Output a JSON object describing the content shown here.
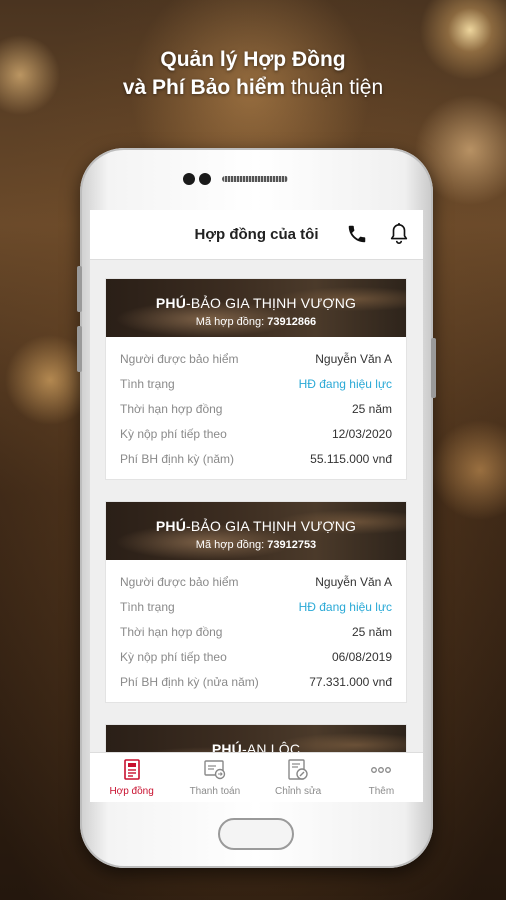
{
  "headline": {
    "line1": "Quản lý Hợp Đồng",
    "line2_bold": "và Phí Bảo hiểm",
    "line2_light": " thuận tiện"
  },
  "app": {
    "title": "Hợp đồng của tôi"
  },
  "contracts": [
    {
      "plan_bold": "PHÚ",
      "plan_rest": "-BẢO GIA THỊNH VƯỢNG",
      "number_label": "Mã hợp đồng: ",
      "number": "73912866",
      "rows": [
        {
          "label": "Người được bảo hiểm",
          "value": "Nguyễn Văn A"
        },
        {
          "label": "Tình trạng",
          "value": "HĐ đang hiệu lực"
        },
        {
          "label": "Thời hạn hợp đồng",
          "value": "25 năm"
        },
        {
          "label": "Kỳ nộp phí tiếp theo",
          "value": "12/03/2020"
        },
        {
          "label": "Phí BH định kỳ (năm)",
          "value": "55.115.000 vnđ"
        }
      ]
    },
    {
      "plan_bold": "PHÚ",
      "plan_rest": "-BẢO GIA THỊNH VƯỢNG",
      "number_label": "Mã hợp đồng: ",
      "number": "73912753",
      "rows": [
        {
          "label": "Người được bảo hiểm",
          "value": "Nguyễn Văn A"
        },
        {
          "label": "Tình trạng",
          "value": "HĐ đang hiệu lực"
        },
        {
          "label": "Thời hạn hợp đồng",
          "value": "25 năm"
        },
        {
          "label": "Kỳ nộp phí tiếp theo",
          "value": "06/08/2019"
        },
        {
          "label": "Phí BH định kỳ (nửa năm)",
          "value": "77.331.000 vnđ"
        }
      ]
    },
    {
      "plan_bold": "PHÚ",
      "plan_rest": "-AN LỘC"
    }
  ],
  "colors": {
    "accent": "#c8102e",
    "status": "#2aa9d6"
  },
  "bottom_nav": [
    {
      "label": "Hợp đồng",
      "icon": "contract-icon",
      "active": true
    },
    {
      "label": "Thanh toán",
      "icon": "payment-icon",
      "active": false
    },
    {
      "label": "Chỉnh sửa",
      "icon": "edit-icon",
      "active": false
    },
    {
      "label": "Thêm",
      "icon": "more-icon",
      "active": false
    }
  ]
}
